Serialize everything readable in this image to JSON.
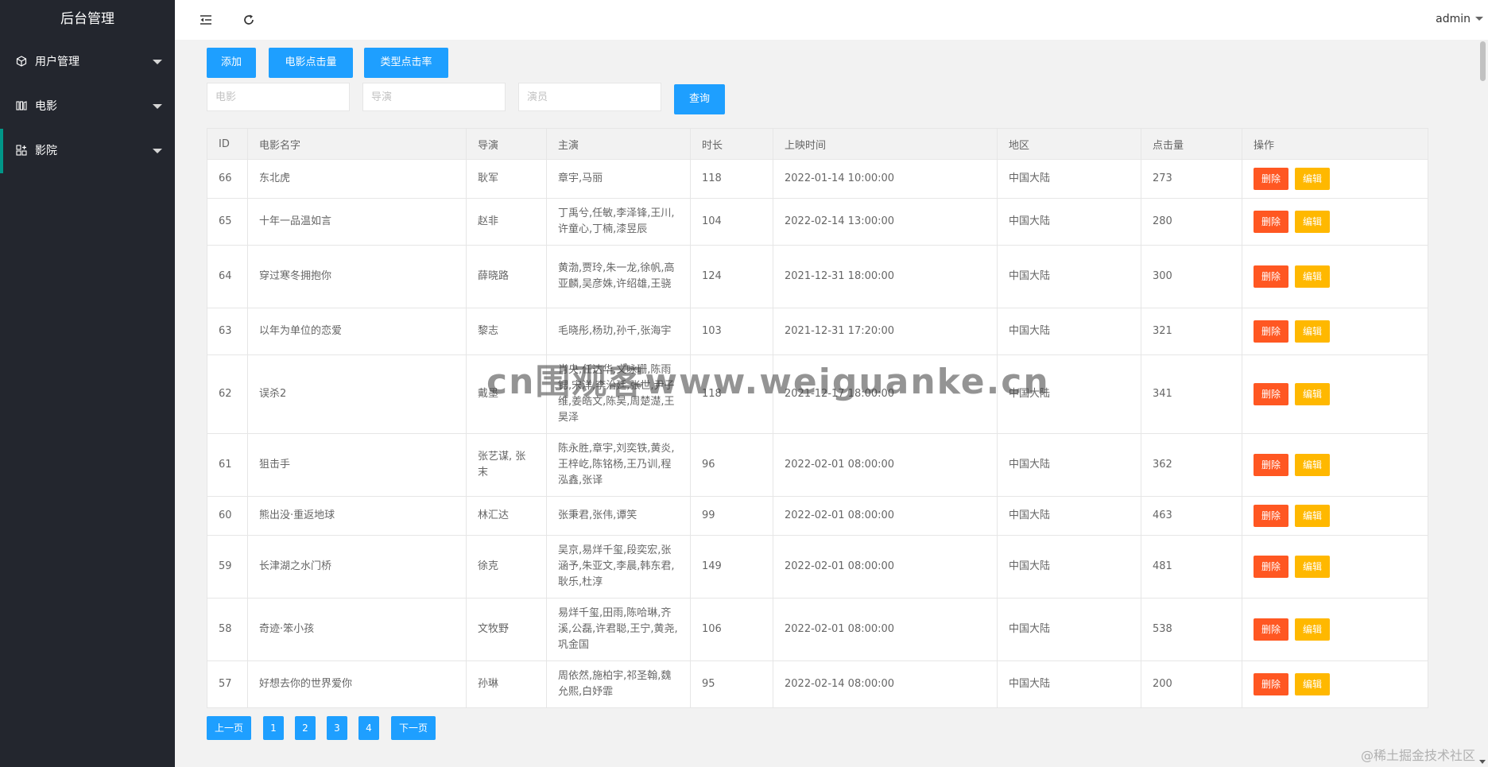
{
  "app": {
    "title": "后台管理"
  },
  "sidebar": {
    "items": [
      {
        "label": "用户管理",
        "icon": "cube-icon"
      },
      {
        "label": "电影",
        "icon": "film-icon"
      },
      {
        "label": "影院",
        "icon": "apps-icon",
        "active": true
      }
    ]
  },
  "topbar": {
    "user": "admin"
  },
  "toolbar": {
    "add_label": "添加",
    "movie_clicks_label": "电影点击量",
    "type_clicks_label": "类型点击率",
    "search_label": "查询"
  },
  "filters": {
    "movie_placeholder": "电影",
    "director_placeholder": "导演",
    "actor_placeholder": "演员"
  },
  "table": {
    "headers": [
      "ID",
      "电影名字",
      "导演",
      "主演",
      "时长",
      "上映时间",
      "地区",
      "点击量",
      "操作"
    ],
    "delete_label": "删除",
    "edit_label": "编辑",
    "rows": [
      {
        "id": "66",
        "name": "东北虎",
        "director": "耿军",
        "cast": "章宇,马丽",
        "duration": "118",
        "release": "2022-01-14 10:00:00",
        "region": "中国大陆",
        "clicks": "273"
      },
      {
        "id": "65",
        "name": "十年一品温如言",
        "director": "赵非",
        "cast": "丁禹兮,任敏,李泽锋,王川,许童心,丁楠,漆昱辰",
        "duration": "104",
        "release": "2022-02-14 13:00:00",
        "region": "中国大陆",
        "clicks": "280"
      },
      {
        "id": "64",
        "name": "穿过寒冬拥抱你",
        "director": "薛晓路",
        "cast": "黄渤,贾玲,朱一龙,徐帆,高亚麟,吴彦姝,许绍雄,王骁",
        "duration": "124",
        "release": "2021-12-31 18:00:00",
        "region": "中国大陆",
        "clicks": "300"
      },
      {
        "id": "63",
        "name": "以年为单位的恋爱",
        "director": "黎志",
        "cast": "毛晓彤,杨玏,孙千,张海宇",
        "duration": "103",
        "release": "2021-12-31 17:20:00",
        "region": "中国大陆",
        "clicks": "321"
      },
      {
        "id": "62",
        "name": "误杀2",
        "director": "戴墨",
        "cast": "肖央,任达华,文咏珊,陈雨锶,宋洋,李治廷,张世,尹子维,姜皓文,陈昊,周楚濋,王昊泽",
        "duration": "118",
        "release": "2021-12-17 18:00:00",
        "region": "中国大陆",
        "clicks": "341"
      },
      {
        "id": "61",
        "name": "狙击手",
        "director": "张艺谋, 张末",
        "cast": "陈永胜,章宇,刘奕铁,黄炎,王梓屹,陈铭杨,王乃训,程泓鑫,张译",
        "duration": "96",
        "release": "2022-02-01 08:00:00",
        "region": "中国大陆",
        "clicks": "362"
      },
      {
        "id": "60",
        "name": "熊出没·重返地球",
        "director": "林汇达",
        "cast": "张秉君,张伟,谭笑",
        "duration": "99",
        "release": "2022-02-01 08:00:00",
        "region": "中国大陆",
        "clicks": "463"
      },
      {
        "id": "59",
        "name": "长津湖之水门桥",
        "director": "徐克",
        "cast": "吴京,易烊千玺,段奕宏,张涵予,朱亚文,李晨,韩东君,耿乐,杜淳",
        "duration": "149",
        "release": "2022-02-01 08:00:00",
        "region": "中国大陆",
        "clicks": "481"
      },
      {
        "id": "58",
        "name": "奇迹·笨小孩",
        "director": "文牧野",
        "cast": "易烊千玺,田雨,陈哈琳,齐溪,公磊,许君聪,王宁,黄尧,巩金国",
        "duration": "106",
        "release": "2022-02-01 08:00:00",
        "region": "中国大陆",
        "clicks": "538"
      },
      {
        "id": "57",
        "name": "好想去你的世界爱你",
        "director": "孙琳",
        "cast": "周依然,施柏宇,祁圣翰,魏允熙,白妤霏",
        "duration": "95",
        "release": "2022-02-14 08:00:00",
        "region": "中国大陆",
        "clicks": "200"
      }
    ]
  },
  "pagination": {
    "prev_label": "上一页",
    "pages": [
      "1",
      "2",
      "3",
      "4"
    ],
    "next_label": "下一页"
  },
  "watermark": "cn围观客www.weiguanke.cn",
  "credit": "@稀土掘金技术社区",
  "colors": {
    "primary": "#1e9fff",
    "danger": "#ff5722",
    "warning": "#ffb800",
    "sidebar": "#23262e",
    "accent": "#009688"
  }
}
